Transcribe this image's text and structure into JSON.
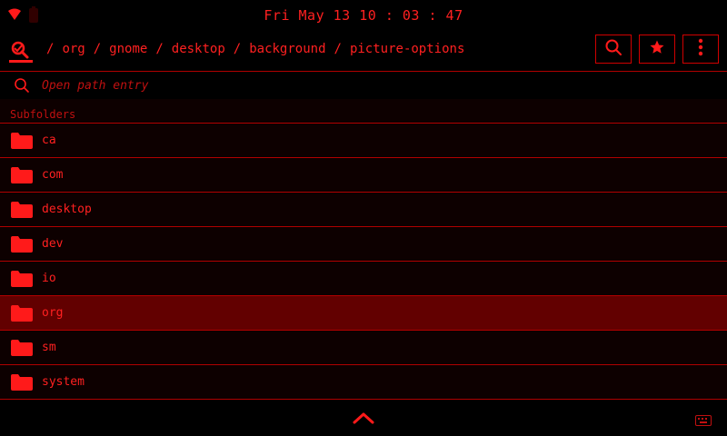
{
  "status": {
    "clock": "Fri May 13 10 : 03 : 47",
    "icons": [
      "wifi-icon",
      "battery-icon"
    ]
  },
  "header": {
    "breadcrumbs": [
      "org",
      "gnome",
      "desktop",
      "background",
      "picture-options"
    ],
    "separator": "/",
    "actions": [
      "search-icon",
      "star-icon",
      "more-vertical-icon"
    ]
  },
  "path_entry": {
    "placeholder": "Open path entry",
    "value": ""
  },
  "list": {
    "section_title": "Subfolders",
    "items": [
      {
        "label": "ca"
      },
      {
        "label": "com"
      },
      {
        "label": "desktop"
      },
      {
        "label": "dev"
      },
      {
        "label": "io"
      },
      {
        "label": "org",
        "selected": true
      },
      {
        "label": "sm"
      },
      {
        "label": "system"
      }
    ]
  },
  "theme": {
    "accent": "#ff1a1a",
    "background": "#000000",
    "row_background": "#0d0000",
    "selected_background": "#620000",
    "border": "#b00000"
  }
}
